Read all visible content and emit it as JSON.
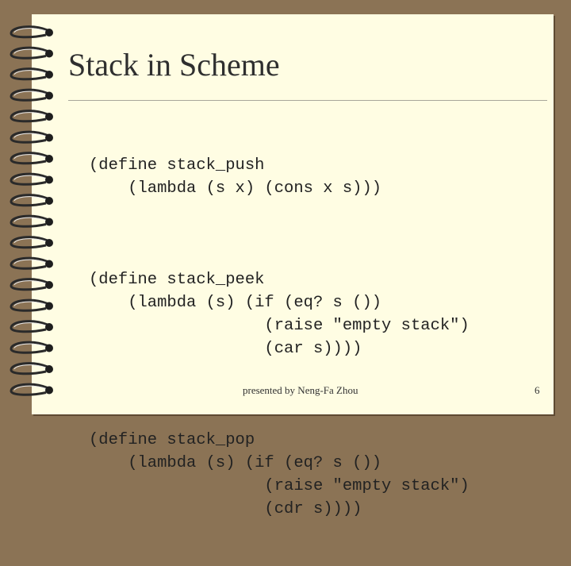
{
  "slide": {
    "title": "Stack in Scheme",
    "code_blocks": [
      "(define stack_push\n    (lambda (s x) (cons x s)))",
      "(define stack_peek\n    (lambda (s) (if (eq? s ())\n                  (raise \"empty stack\")\n                  (car s))))",
      "(define stack_pop\n    (lambda (s) (if (eq? s ())\n                  (raise \"empty stack\")\n                  (cdr s))))"
    ],
    "footer": "presented by Neng-Fa Zhou",
    "page_number": "6"
  },
  "colors": {
    "frame": "#8b7355",
    "paper": "#fffde3",
    "text": "#222222"
  },
  "icons": {
    "binding": "spiral-binding-ring-icon"
  }
}
